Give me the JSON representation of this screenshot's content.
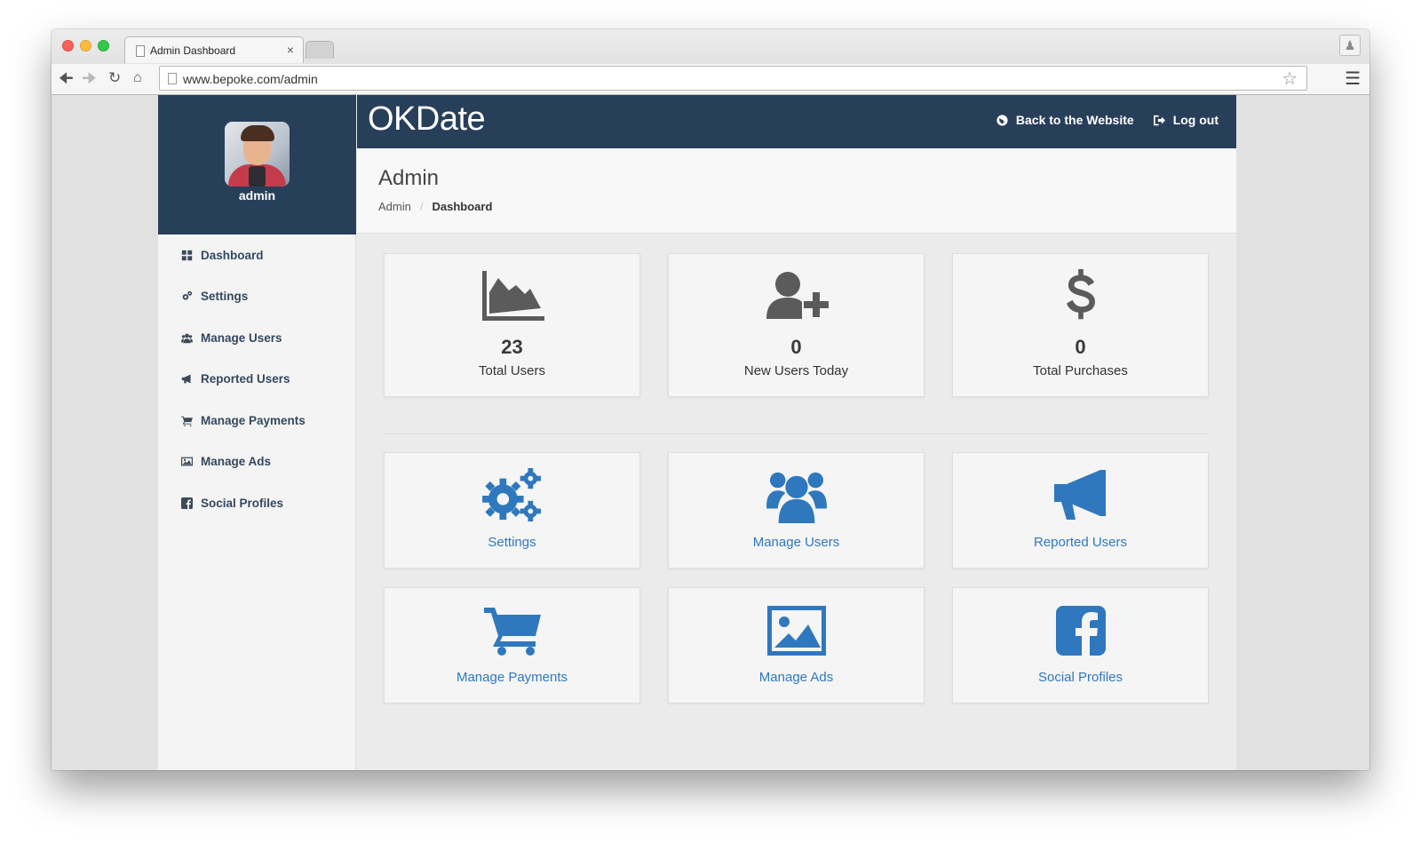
{
  "browser": {
    "tab_title": "Admin Dashboard",
    "tab_close": "×",
    "url": "www.bepoke.com/admin"
  },
  "app": {
    "brand": "OKDate",
    "top_links": {
      "back": "Back to the Website",
      "logout": "Log out"
    }
  },
  "sidebar": {
    "username": "admin",
    "items": [
      {
        "label": "Dashboard",
        "icon": "dashboard-icon"
      },
      {
        "label": "Settings",
        "icon": "gears-icon"
      },
      {
        "label": "Manage Users",
        "icon": "users-icon"
      },
      {
        "label": "Reported Users",
        "icon": "megaphone-icon"
      },
      {
        "label": "Manage Payments",
        "icon": "cart-icon"
      },
      {
        "label": "Manage Ads",
        "icon": "image-icon"
      },
      {
        "label": "Social Profiles",
        "icon": "facebook-icon"
      }
    ]
  },
  "header": {
    "title": "Admin",
    "breadcrumb": [
      "Admin",
      "Dashboard"
    ],
    "breadcrumb_separator": "/"
  },
  "stats": [
    {
      "value": "23",
      "label": "Total Users",
      "icon": "area-chart-icon"
    },
    {
      "value": "0",
      "label": "New Users Today",
      "icon": "user-plus-icon"
    },
    {
      "value": "0",
      "label": "Total Purchases",
      "icon": "dollar-icon"
    }
  ],
  "nav_cards": [
    {
      "label": "Settings",
      "icon": "gears-icon"
    },
    {
      "label": "Manage Users",
      "icon": "users-icon"
    },
    {
      "label": "Reported Users",
      "icon": "megaphone-icon"
    },
    {
      "label": "Manage Payments",
      "icon": "cart-icon"
    },
    {
      "label": "Manage Ads",
      "icon": "image-icon"
    },
    {
      "label": "Social Profiles",
      "icon": "facebook-icon"
    }
  ],
  "colors": {
    "navy": "#283f5a",
    "link_blue": "#2f78be",
    "stat_icon_gray": "#5b5b5b"
  }
}
